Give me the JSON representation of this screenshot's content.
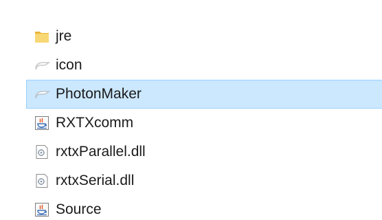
{
  "files": [
    {
      "name": "jre",
      "icon": "folder-icon"
    },
    {
      "name": "icon",
      "icon": "shortcut-icon"
    },
    {
      "name": "PhotonMaker",
      "icon": "shortcut-icon",
      "selected": true
    },
    {
      "name": "RXTXcomm",
      "icon": "java-jar-icon"
    },
    {
      "name": "rxtxParallel.dll",
      "icon": "dll-file-icon"
    },
    {
      "name": "rxtxSerial.dll",
      "icon": "dll-file-icon"
    },
    {
      "name": "Source",
      "icon": "java-jar-icon"
    }
  ],
  "colors": {
    "selection_fill": "#cce8ff",
    "selection_border": "#99d1ff",
    "folder": "#f8d775",
    "text": "#1a1a1a"
  }
}
